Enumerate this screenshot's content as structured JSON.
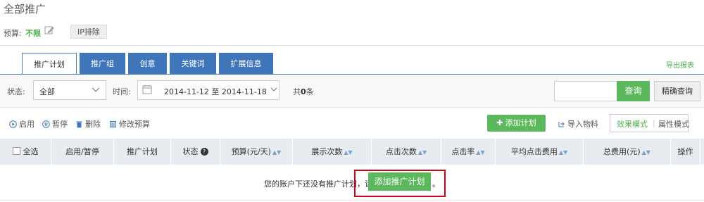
{
  "page": {
    "title": "全部推广"
  },
  "budget": {
    "label": "预算:",
    "value": "不限",
    "ip_exclude": "IP排除"
  },
  "tabs": [
    {
      "label": "推广计划",
      "active": true
    },
    {
      "label": "推广组",
      "active": false
    },
    {
      "label": "创意",
      "active": false
    },
    {
      "label": "关键词",
      "active": false
    },
    {
      "label": "扩展信息",
      "active": false
    }
  ],
  "export_label": "导出报表",
  "filters": {
    "status_label": "状态:",
    "status_value": "全部",
    "time_label": "时间:",
    "date_range": "2014-11-12 至 2014-11-18",
    "count_prefix": "共",
    "count_value": "0",
    "count_suffix": "条",
    "search_placeholder": "",
    "query_button": "查询",
    "precise_button": "精确查询"
  },
  "toolbar": {
    "enable": "启用",
    "pause": "暂停",
    "delete": "删除",
    "edit_budget": "修改预算",
    "add_plan": "添加计划",
    "import": "导入物料",
    "mode_effect": "效果模式",
    "mode_attr": "属性模式"
  },
  "table": {
    "columns": {
      "select_all": "全选",
      "toggle": "启用/暂停",
      "plan": "推广计划",
      "status": "状态",
      "budget": "预算(元/天)",
      "impressions": "展示次数",
      "clicks": "点击次数",
      "ctr": "点击率",
      "avg_cpc": "平均点击费用",
      "total_cost": "总费用(元)",
      "actions": "操作"
    },
    "empty_message": "您的账户下还没有推广计划，请",
    "empty_add_button": "添加推广计划",
    "empty_suffix": "。"
  },
  "colors": {
    "accent_green": "#5cb85c",
    "tab_blue": "#3f76b9",
    "highlight_red": "#d0021b"
  }
}
